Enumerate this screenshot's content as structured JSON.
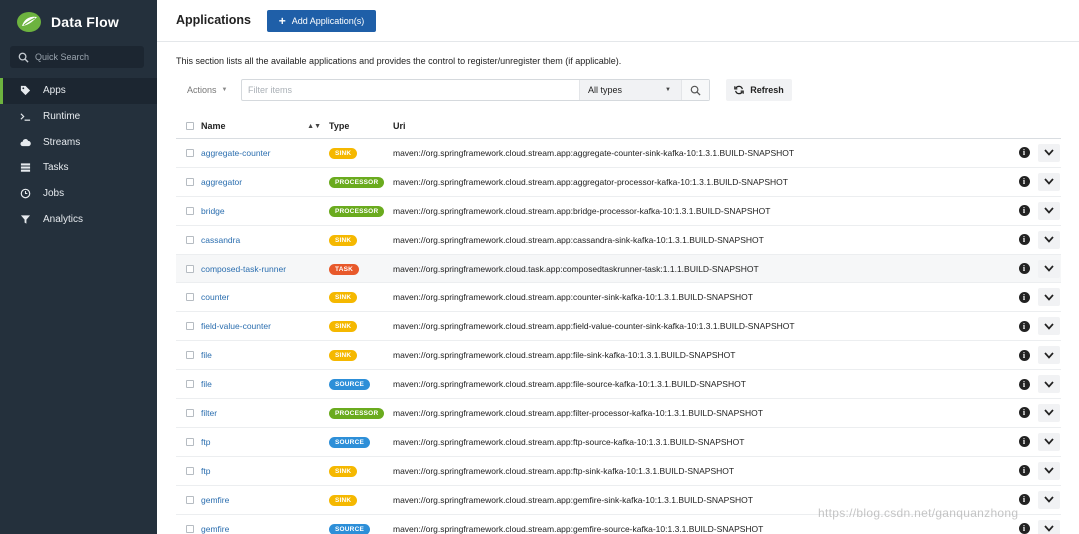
{
  "brand": {
    "title": "Data Flow"
  },
  "sidebar": {
    "search_placeholder": "Quick Search",
    "items": [
      {
        "label": "Apps",
        "icon": "tag-icon",
        "active": true
      },
      {
        "label": "Runtime",
        "icon": "terminal-icon"
      },
      {
        "label": "Streams",
        "icon": "cloud-icon"
      },
      {
        "label": "Tasks",
        "icon": "list-icon"
      },
      {
        "label": "Jobs",
        "icon": "clock-icon"
      },
      {
        "label": "Analytics",
        "icon": "filter-icon"
      }
    ]
  },
  "header": {
    "title": "Applications",
    "add_button": "Add Application(s)"
  },
  "description": "This section lists all the available applications and provides the control to register/unregister them (if applicable).",
  "toolbar": {
    "actions_label": "Actions",
    "filter_placeholder": "Filter items",
    "types_selected": "All types",
    "refresh_label": "Refresh"
  },
  "table": {
    "headers": {
      "name": "Name",
      "type": "Type",
      "uri": "Uri"
    },
    "rows": [
      {
        "name": "aggregate-counter",
        "type": "SINK",
        "uri": "maven://org.springframework.cloud.stream.app:aggregate-counter-sink-kafka-10:1.3.1.BUILD-SNAPSHOT"
      },
      {
        "name": "aggregator",
        "type": "PROCESSOR",
        "uri": "maven://org.springframework.cloud.stream.app:aggregator-processor-kafka-10:1.3.1.BUILD-SNAPSHOT"
      },
      {
        "name": "bridge",
        "type": "PROCESSOR",
        "uri": "maven://org.springframework.cloud.stream.app:bridge-processor-kafka-10:1.3.1.BUILD-SNAPSHOT"
      },
      {
        "name": "cassandra",
        "type": "SINK",
        "uri": "maven://org.springframework.cloud.stream.app:cassandra-sink-kafka-10:1.3.1.BUILD-SNAPSHOT"
      },
      {
        "name": "composed-task-runner",
        "type": "TASK",
        "uri": "maven://org.springframework.cloud.task.app:composedtaskrunner-task:1.1.1.BUILD-SNAPSHOT",
        "highlighted": true
      },
      {
        "name": "counter",
        "type": "SINK",
        "uri": "maven://org.springframework.cloud.stream.app:counter-sink-kafka-10:1.3.1.BUILD-SNAPSHOT"
      },
      {
        "name": "field-value-counter",
        "type": "SINK",
        "uri": "maven://org.springframework.cloud.stream.app:field-value-counter-sink-kafka-10:1.3.1.BUILD-SNAPSHOT"
      },
      {
        "name": "file",
        "type": "SINK",
        "uri": "maven://org.springframework.cloud.stream.app:file-sink-kafka-10:1.3.1.BUILD-SNAPSHOT"
      },
      {
        "name": "file",
        "type": "SOURCE",
        "uri": "maven://org.springframework.cloud.stream.app:file-source-kafka-10:1.3.1.BUILD-SNAPSHOT"
      },
      {
        "name": "filter",
        "type": "PROCESSOR",
        "uri": "maven://org.springframework.cloud.stream.app:filter-processor-kafka-10:1.3.1.BUILD-SNAPSHOT"
      },
      {
        "name": "ftp",
        "type": "SOURCE",
        "uri": "maven://org.springframework.cloud.stream.app:ftp-source-kafka-10:1.3.1.BUILD-SNAPSHOT"
      },
      {
        "name": "ftp",
        "type": "SINK",
        "uri": "maven://org.springframework.cloud.stream.app:ftp-sink-kafka-10:1.3.1.BUILD-SNAPSHOT"
      },
      {
        "name": "gemfire",
        "type": "SINK",
        "uri": "maven://org.springframework.cloud.stream.app:gemfire-sink-kafka-10:1.3.1.BUILD-SNAPSHOT"
      },
      {
        "name": "gemfire",
        "type": "SOURCE",
        "uri": "maven://org.springframework.cloud.stream.app:gemfire-source-kafka-10:1.3.1.BUILD-SNAPSHOT"
      }
    ]
  },
  "type_colors": {
    "SINK": "#f5b800",
    "PROCESSOR": "#6aab1e",
    "TASK": "#e8592b",
    "SOURCE": "#2d8fd8"
  },
  "watermark": "https://blog.csdn.net/ganquanzhong"
}
